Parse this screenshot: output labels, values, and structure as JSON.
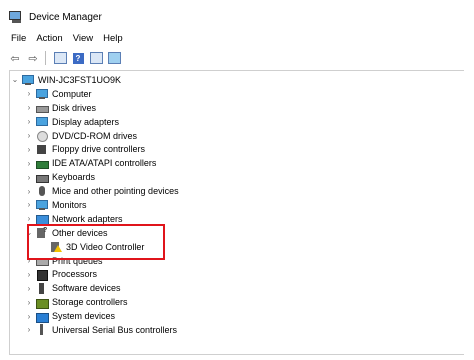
{
  "window": {
    "title": "Device Manager"
  },
  "menu": [
    "File",
    "Action",
    "View",
    "Help"
  ],
  "toolbar": {
    "back": "back-arrow-icon",
    "forward": "forward-arrow-icon",
    "properties": "properties-icon",
    "help": "?",
    "update": "update-icon",
    "scan": "scan-monitor-icon"
  },
  "tree": {
    "root": {
      "label": "WIN-JC3FST1UO9K",
      "icon": "computer-icon"
    },
    "items": [
      {
        "label": "Computer",
        "icon": "computer-icon",
        "expanded": false
      },
      {
        "label": "Disk drives",
        "icon": "drive-icon",
        "expanded": false
      },
      {
        "label": "Display adapters",
        "icon": "display-icon",
        "expanded": false
      },
      {
        "label": "DVD/CD-ROM drives",
        "icon": "dvd-icon",
        "expanded": false
      },
      {
        "label": "Floppy drive controllers",
        "icon": "floppy-icon",
        "expanded": false
      },
      {
        "label": "IDE ATA/ATAPI controllers",
        "icon": "ide-icon",
        "expanded": false
      },
      {
        "label": "Keyboards",
        "icon": "keyboard-icon",
        "expanded": false
      },
      {
        "label": "Mice and other pointing devices",
        "icon": "mouse-icon",
        "expanded": false
      },
      {
        "label": "Monitors",
        "icon": "monitor-icon",
        "expanded": false
      },
      {
        "label": "Network adapters",
        "icon": "network-icon",
        "expanded": false
      },
      {
        "label": "Other devices",
        "icon": "other-devices-icon",
        "expanded": true,
        "children": [
          {
            "label": "3D Video Controller",
            "icon": "warning-device-icon"
          }
        ]
      },
      {
        "label": "Print queues",
        "icon": "printer-icon",
        "expanded": false
      },
      {
        "label": "Processors",
        "icon": "processor-icon",
        "expanded": false
      },
      {
        "label": "Software devices",
        "icon": "software-icon",
        "expanded": false
      },
      {
        "label": "Storage controllers",
        "icon": "storage-icon",
        "expanded": false
      },
      {
        "label": "System devices",
        "icon": "system-icon",
        "expanded": false
      },
      {
        "label": "Universal Serial Bus controllers",
        "icon": "usb-icon",
        "expanded": false
      }
    ]
  },
  "colors": {
    "highlight": "#e0141b"
  }
}
